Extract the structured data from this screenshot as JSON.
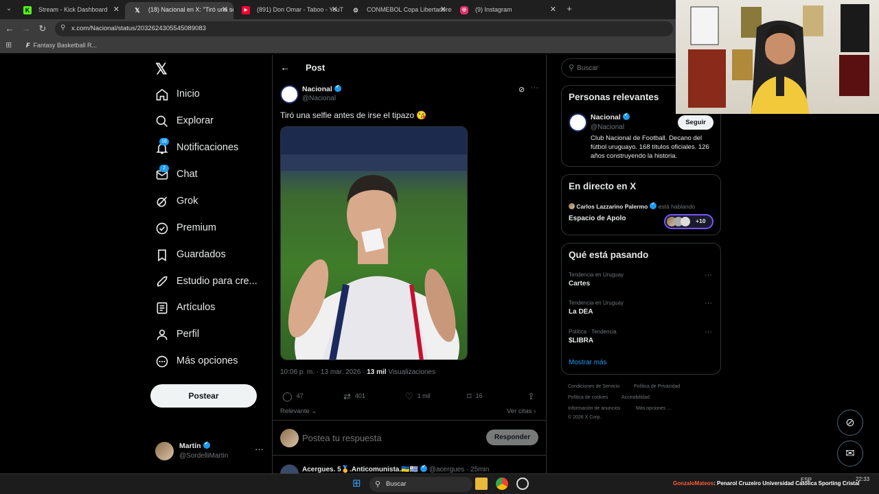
{
  "browser": {
    "tabs": [
      {
        "title": "Stream - Kick Dashboard",
        "icon": "kick-icon",
        "color": "#53fc18"
      },
      {
        "title": "(18) Nacional en X: \"Tiró una se",
        "icon": "x-icon",
        "color": "#ffffff"
      },
      {
        "title": "(891) Don Omar - Taboo - YouT",
        "icon": "youtube-icon",
        "color": "#ff0033"
      },
      {
        "title": "CONMEBOL Copa Libertadores",
        "icon": "globe-icon",
        "color": "#cccccc"
      },
      {
        "title": "(9) Instagram",
        "icon": "instagram-icon",
        "color": "#e1306c"
      }
    ],
    "url": "x.com/Nacional/status/2032624305545089083",
    "bookmark": "Fantasy Basketball R..."
  },
  "nav": {
    "items": [
      {
        "label": "Inicio",
        "icon": "home-icon",
        "badge": ""
      },
      {
        "label": "Explorar",
        "icon": "search-icon",
        "badge": ""
      },
      {
        "label": "Notificaciones",
        "icon": "bell-icon",
        "badge": "16"
      },
      {
        "label": "Chat",
        "icon": "mail-icon",
        "badge": "2"
      },
      {
        "label": "Grok",
        "icon": "grok-icon",
        "badge": ""
      },
      {
        "label": "Premium",
        "icon": "premium-icon",
        "badge": ""
      },
      {
        "label": "Guardados",
        "icon": "bookmark-icon",
        "badge": ""
      },
      {
        "label": "Estudio para cre...",
        "icon": "rocket-icon",
        "badge": ""
      },
      {
        "label": "Artículos",
        "icon": "article-icon",
        "badge": ""
      },
      {
        "label": "Perfil",
        "icon": "person-icon",
        "badge": ""
      },
      {
        "label": "Más opciones",
        "icon": "more-circle-icon",
        "badge": ""
      }
    ],
    "post_button": "Postear",
    "account": {
      "name": "Martín",
      "handle": "@SordelliMartin"
    }
  },
  "post": {
    "header": "Post",
    "author": "Nacional",
    "handle": "@Nacional",
    "text": "Tiró una selfie antes de irse el tipazo 😘",
    "time": "10:06 p. m. · 13 mar. 2026 · ",
    "views": "13 mil",
    "views_label": " Visualizaciones",
    "actions": {
      "replies": "47",
      "reposts": "401",
      "likes": "1 mil",
      "bookmarks": "16"
    },
    "sort": "Relevante",
    "quotes": "Ver citas",
    "reply_placeholder": "Postea tu respuesta",
    "reply_button": "Responder",
    "next_author": "Acergues. 5🥇.Anticomunista.🇺🇦🇺🇾",
    "next_handle": "@acergues · 25min"
  },
  "sidebar": {
    "search_placeholder": "Buscar",
    "relevant_title": "Personas relevantes",
    "relevant": {
      "name": "Nacional",
      "handle": "@Nacional",
      "follow": "Seguir",
      "bio": "Club Nacional de Football. Decano del fútbol uruguayo. 168 títulos oficiales. 126 años construyendo la historia."
    },
    "live_title": "En directo en X",
    "live": {
      "host": "Carlos Lazzarino Palermo",
      "status": "está hablando",
      "space": "Espacio de Apolo",
      "count": "+10"
    },
    "trends_title": "Qué está pasando",
    "trends": [
      {
        "context": "Tendencia en Uruguay",
        "name": "Cartes"
      },
      {
        "context": "Tendencia en Uruguay",
        "name": "La DEA"
      },
      {
        "context": "Política · Tendencia",
        "name": "$LIBRA"
      }
    ],
    "show_more": "Mostrar más",
    "footer": [
      "Condiciones de Servicio",
      "Política de Privacidad",
      "Política de cookies",
      "Accesibilidad",
      "Información de anuncios",
      "Más opciones ...",
      "© 2026 X Corp."
    ]
  },
  "taskbar": {
    "search": "Buscar",
    "ticker_user": "GonzaloMateos",
    "ticker_text": ": Penarol Cruzeiro Universidad Católica Sporting Cristal",
    "lang": "ESP",
    "time": "22:33"
  },
  "colors": {
    "accent": "#1d9bf0",
    "bg": "#000000",
    "border": "#2f3336"
  }
}
